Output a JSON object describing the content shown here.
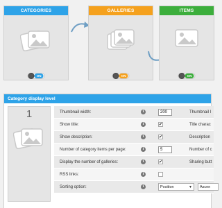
{
  "colors": {
    "categories": "#2ea3e8",
    "galleries": "#f5a11d",
    "items": "#3cae3c",
    "panel_header": "#2ea3e8",
    "arrow": "#6f9fc4"
  },
  "cards": [
    {
      "id": "categories",
      "title": "CATEGORIES",
      "toggle": "ON",
      "toggle_color": "#2ea3e8",
      "icon": "images-icon"
    },
    {
      "id": "galleries",
      "title": "GALLERIES",
      "toggle": "ON",
      "toggle_color": "#f5a11d",
      "icon": "images-icon"
    },
    {
      "id": "items",
      "title": "ITEMS",
      "toggle": "ON",
      "toggle_color": "#3cae3c",
      "icon": "image-icon"
    }
  ],
  "panel": {
    "title": "Category display level",
    "level": "1",
    "rows": [
      {
        "label": "Thumbnail width:",
        "info": "i",
        "control": "number",
        "value": "200",
        "right": "Thumbnail l"
      },
      {
        "label": "Show title:",
        "info": "i",
        "control": "checkbox",
        "checked": true,
        "right": "Title charac"
      },
      {
        "label": "Show description:",
        "info": "i",
        "control": "checkbox",
        "checked": true,
        "right": "Description"
      },
      {
        "label": "Number of category items per page:",
        "info": "i",
        "control": "number",
        "value": "5",
        "right": "Number of c"
      },
      {
        "label": "Display the number of galleries:",
        "info": "i",
        "control": "checkbox",
        "checked": true,
        "right": "Sharing butt"
      },
      {
        "label": "RSS links:",
        "info": "i",
        "control": "checkbox",
        "checked": false,
        "right": ""
      },
      {
        "label": "Sorting option:",
        "info": "i",
        "control": "select",
        "value": "Position",
        "value2": "Ascen",
        "right": ""
      }
    ]
  }
}
